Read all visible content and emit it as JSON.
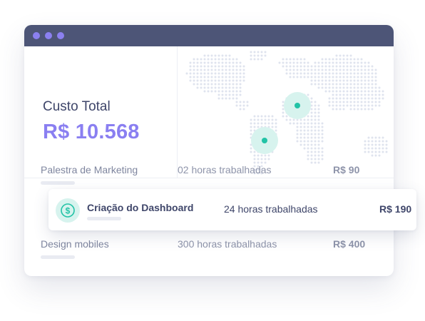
{
  "window": {
    "title_dots": [
      "dot",
      "dot",
      "dot"
    ]
  },
  "summary": {
    "label": "Custo Total",
    "value": "R$ 10.568"
  },
  "map": {
    "markers": [
      "north-africa-marker",
      "south-america-marker"
    ],
    "marker_color": "#22c3a6",
    "halo_color": "#d7f3ee"
  },
  "rows": [
    {
      "name": "Palestra de Marketing",
      "hours": "02 horas trabalhadas",
      "price": "R$ 90"
    },
    {
      "name": "Criação do Dashboard",
      "hours": "24 horas trabalhadas",
      "price": "R$ 190"
    },
    {
      "name": "Design mobiles",
      "hours": "300 horas trabalhadas",
      "price": "R$ 400"
    }
  ],
  "colors": {
    "titlebar": "#4d5577",
    "accent": "#8a7ff1",
    "text_dark": "#3f466a",
    "text_muted": "#8e94aa",
    "teal": "#22c3a6"
  },
  "icons": {
    "highlight_row_icon": "dollar-coin-icon"
  }
}
